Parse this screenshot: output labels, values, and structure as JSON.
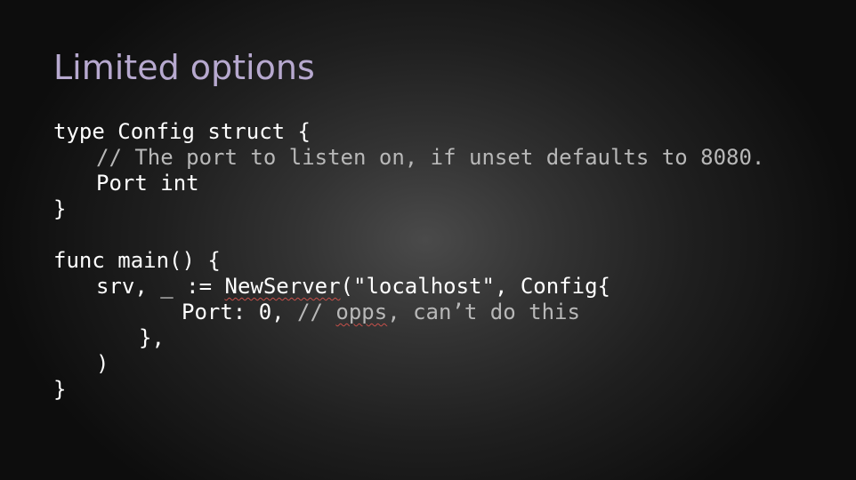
{
  "slide": {
    "title": "Limited options",
    "code": {
      "line1": "type Config struct {",
      "line2_comment": "// The port to listen on, if unset defaults to 8080.",
      "line3": "Port int",
      "line4": "}",
      "line6": "func main() {",
      "line7_prefix": "srv, _ := ",
      "line7_func": "NewServer",
      "line7_suffix": "(\"localhost\", Config{",
      "line8_code": "Port: 0, ",
      "line8_comment_start": "// ",
      "line8_comment_squiggle": "opps",
      "line8_comment_end": ", can’t do this",
      "line9": "},",
      "line10": ")",
      "line11": "}"
    },
    "colors": {
      "title": "#b7a9cf",
      "code": "#ffffff",
      "comment": "#b8b8b8",
      "spellcheck_underline": "#c8504a"
    }
  }
}
